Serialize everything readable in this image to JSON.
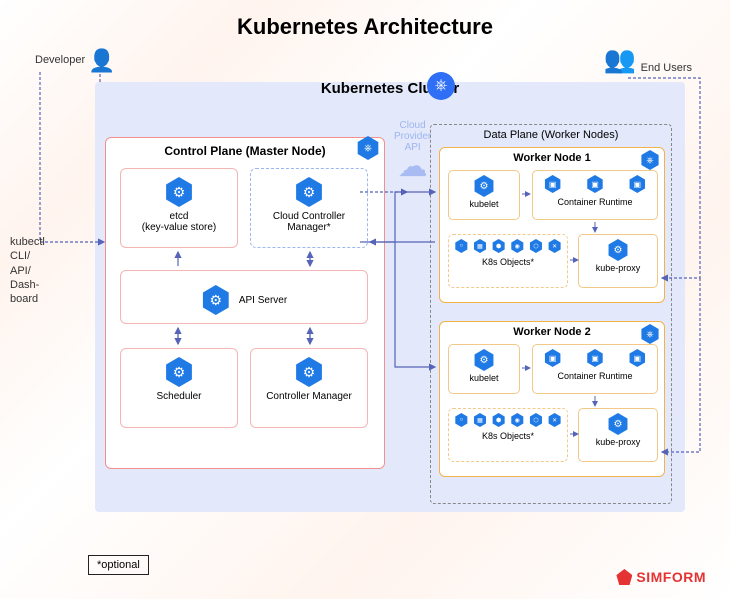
{
  "title": "Kubernetes Architecture",
  "actors": {
    "developer": "Developer",
    "endUsers": "End Users"
  },
  "cluster": {
    "title": "Kubernetes Cluster"
  },
  "cloud": {
    "label1": "Cloud",
    "label2": "Provider",
    "label3": "API"
  },
  "controlPlane": {
    "title": "Control Plane (Master Node)",
    "etcd": {
      "label1": "etcd",
      "label2": "(key-value store)"
    },
    "ccm": {
      "label1": "Cloud Controller",
      "label2": "Manager*"
    },
    "api": "API Server",
    "sched": "Scheduler",
    "cm": "Controller Manager"
  },
  "dataPlane": {
    "title": "Data Plane (Worker Nodes)",
    "worker1": "Worker Node 1",
    "worker2": "Worker Node 2",
    "kubelet": "kubelet",
    "crt": "Container Runtime",
    "k8sobj": "K8s Objects*",
    "kproxy": "kube-proxy"
  },
  "kubectl": {
    "l1": "kubectl",
    "l2": "CLI/",
    "l3": "API/",
    "l4": "Dash-",
    "l5": "board"
  },
  "optional": "*optional",
  "brand": "SIMFORM"
}
